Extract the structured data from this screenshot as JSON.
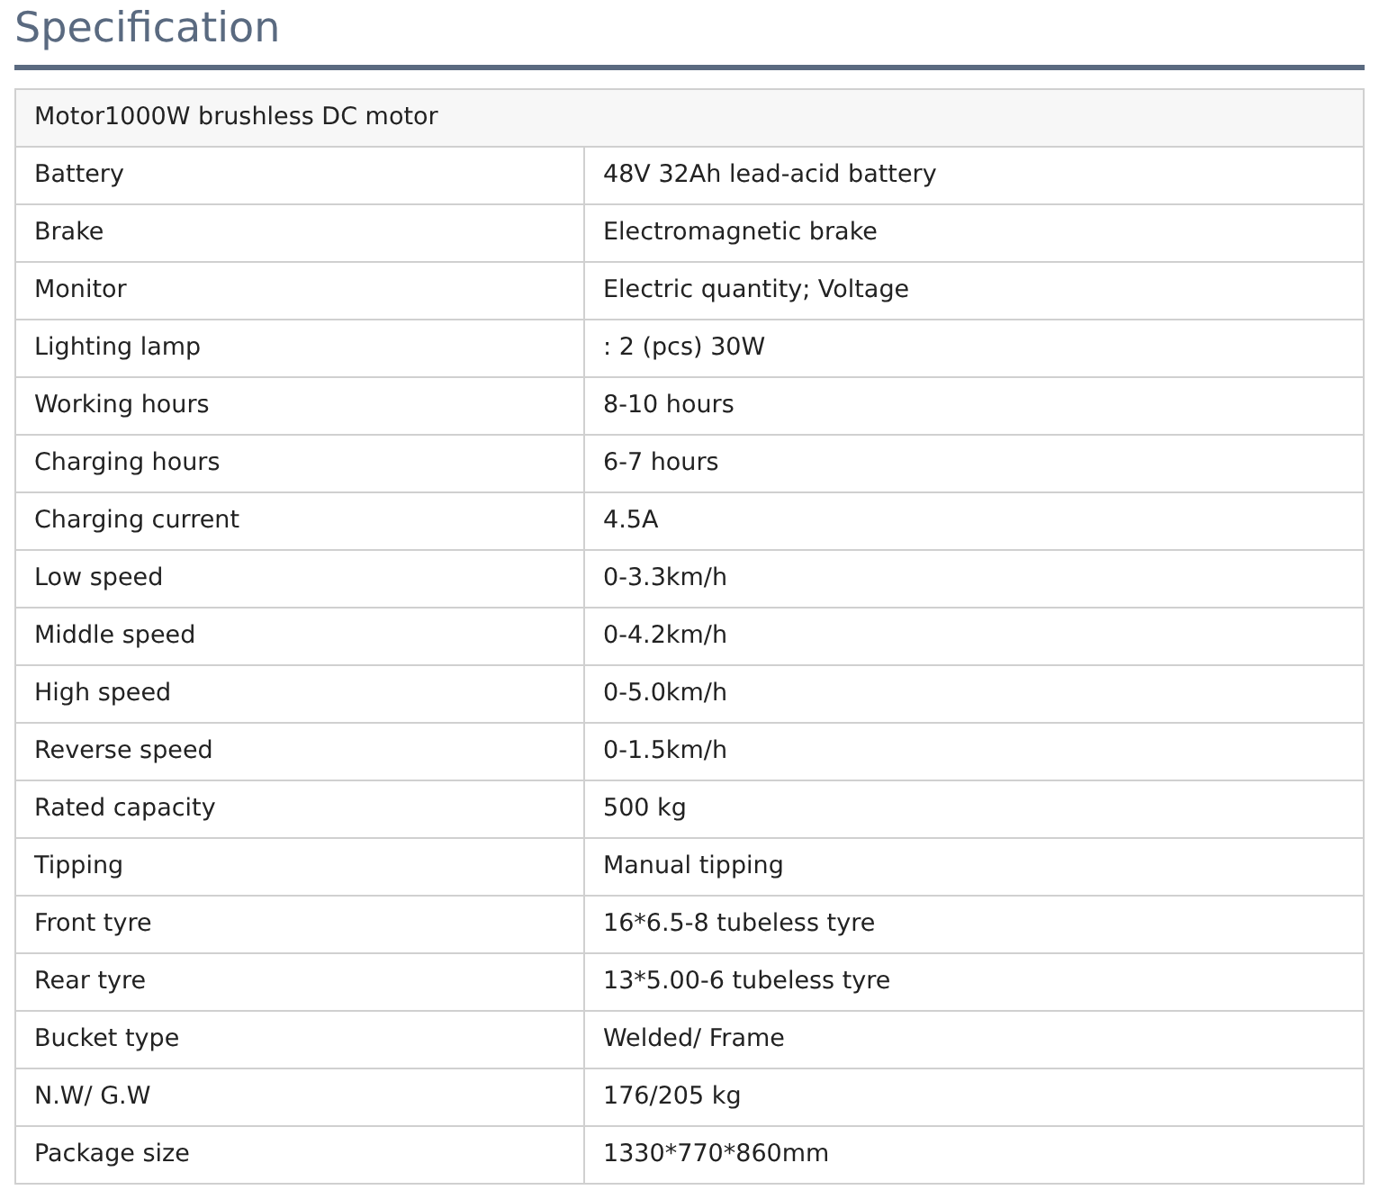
{
  "title": "Specification",
  "table": {
    "header": "Motor1000W brushless DC motor",
    "rows": [
      {
        "label": "Battery",
        "value": "48V 32Ah lead-acid battery"
      },
      {
        "label": "Brake",
        "value": "Electromagnetic brake"
      },
      {
        "label": "Monitor",
        "value": "Electric quantity; Voltage"
      },
      {
        "label": "Lighting lamp",
        "value": ": 2 (pcs) 30W"
      },
      {
        "label": "Working hours",
        "value": "8-10 hours"
      },
      {
        "label": "Charging hours",
        "value": "6-7 hours"
      },
      {
        "label": "Charging current",
        "value": "4.5A"
      },
      {
        "label": "Low speed",
        "value": "0-3.3km/h"
      },
      {
        "label": "Middle speed",
        "value": "0-4.2km/h"
      },
      {
        "label": "High speed",
        "value": "0-5.0km/h"
      },
      {
        "label": "Reverse speed",
        "value": "0-1.5km/h"
      },
      {
        "label": "Rated capacity",
        "value": "500 kg"
      },
      {
        "label": "Tipping",
        "value": "Manual tipping"
      },
      {
        "label": "Front tyre",
        "value": "16*6.5-8 tubeless tyre"
      },
      {
        "label": "Rear tyre",
        "value": "13*5.00-6 tubeless tyre"
      },
      {
        "label": "Bucket type",
        "value": "Welded/ Frame"
      },
      {
        "label": "N.W/ G.W",
        "value": "176/205 kg"
      },
      {
        "label": "Package size",
        "value": "1330*770*860mm"
      }
    ]
  }
}
